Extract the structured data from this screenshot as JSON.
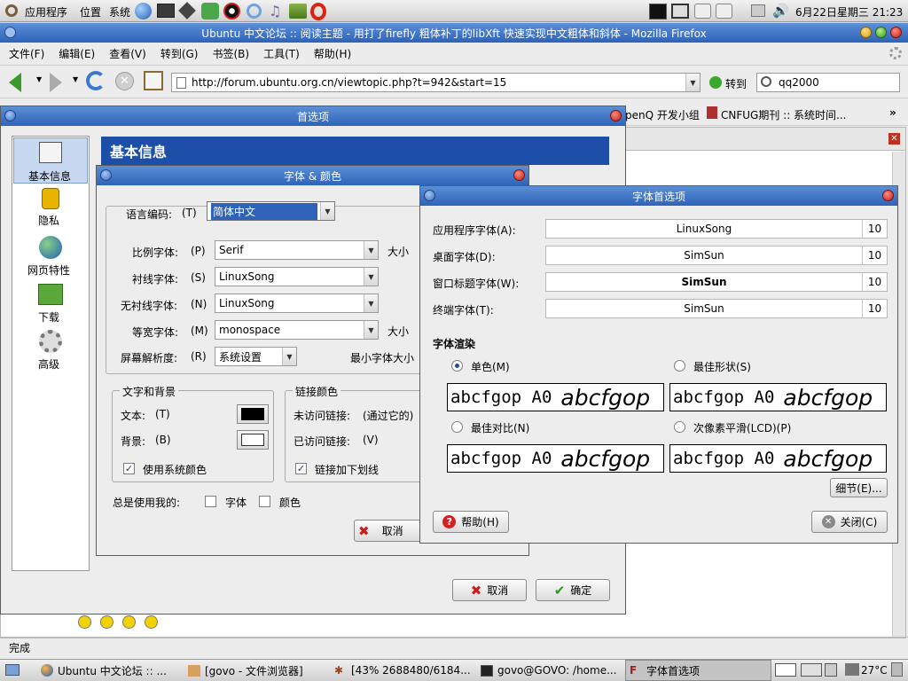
{
  "top_panel": {
    "apps": "应用程序",
    "places": "位置",
    "system": "系统",
    "clock": "6月22日星期三 21:23"
  },
  "firefox": {
    "title": "Ubuntu 中文论坛 :: 阅读主题 - 用打了firefly 粗体补丁的libXft 快速实现中文粗体和斜体 - Mozilla Firefox",
    "menu": [
      "文件(F)",
      "编辑(E)",
      "查看(V)",
      "转到(G)",
      "书签(B)",
      "工具(T)",
      "帮助(H)"
    ],
    "url": "http://forum.ubuntu.org.cn/viewtopic.php?t=942&start=15",
    "go_label": "转到",
    "search_value": "qq2000",
    "bookmarks": [
      "penQ 开发小组",
      "CNFUG期刊 :: 系统时间..."
    ],
    "status": "完成"
  },
  "prefs": {
    "title": "首选项",
    "sidebar": [
      {
        "label": "基本信息",
        "icon": "sliders-icon"
      },
      {
        "label": "隐私",
        "icon": "lock-icon"
      },
      {
        "label": "网页特性",
        "icon": "globe-icon"
      },
      {
        "label": "下载",
        "icon": "download-icon"
      },
      {
        "label": "高级",
        "icon": "gear-icon"
      }
    ],
    "header": "基本信息",
    "cancel": "取消",
    "ok": "确定"
  },
  "fonts_colors": {
    "title": "字体 & 颜色",
    "encoding_label": "语言编码:",
    "encoding_key": "(T)",
    "encoding_value": "简体中文",
    "rows": [
      {
        "label": "比例字体:",
        "key": "(P)",
        "value": "Serif"
      },
      {
        "label": "衬线字体:",
        "key": "(S)",
        "value": "LinuxSong"
      },
      {
        "label": "无衬线字体:",
        "key": "(N)",
        "value": "LinuxSong"
      },
      {
        "label": "等宽字体:",
        "key": "(M)",
        "value": "monospace"
      }
    ],
    "size_label": "大小",
    "resolution_label": "屏幕解析度:",
    "resolution_key": "(R)",
    "resolution_value": "系统设置",
    "min_size_label": "最小字体大小",
    "text_bg_title": "文字和背景",
    "text_label": "文本:",
    "text_key": "(T)",
    "bg_label": "背景:",
    "bg_key": "(B)",
    "use_system_colors": "使用系统颜色",
    "link_colors_title": "链接颜色",
    "unvisited_label": "未访问链接:",
    "unvisited_hint": "(通过它的)",
    "visited_label": "已访问链接:",
    "visited_key": "(V)",
    "underline_links": "链接加下划线",
    "always_use": "总是使用我的:",
    "fonts_opt": "字体",
    "colors_opt": "颜色",
    "cancel": "取消"
  },
  "font_prefs": {
    "title": "字体首选项",
    "rows": [
      {
        "label": "应用程序字体(A):",
        "font": "LinuxSong",
        "size": "10"
      },
      {
        "label": "桌面字体(D):",
        "font": "SimSun",
        "size": "10"
      },
      {
        "label": "窗口标题字体(W):",
        "font": "SimSun",
        "size": "10"
      },
      {
        "label": "终端字体(T):",
        "font": "SimSun",
        "size": "10"
      }
    ],
    "rendering_title": "字体渲染",
    "options": [
      {
        "label": "单色(M)",
        "selected": true
      },
      {
        "label": "最佳形状(S)",
        "selected": false
      },
      {
        "label": "最佳对比(N)",
        "selected": false
      },
      {
        "label": "次像素平滑(LCD)(P)",
        "selected": false
      }
    ],
    "sample_mono": "abcfgop A0",
    "sample_italic": "abcfgop",
    "details": "细节(E)...",
    "help": "帮助(H)",
    "close": "关闭(C)"
  },
  "taskbar": {
    "items": [
      "Ubuntu 中文论坛 :: ...",
      "[govo - 文件浏览器]",
      "[43% 2688480/6184...",
      "govo@GOVO: /home...",
      "字体首选项"
    ],
    "temp": "27°C"
  },
  "colors": {
    "title_blue": "#2f63b9",
    "header_blue": "#1d4fa8",
    "panel_gray": "#d6d6d6",
    "dialog_bg": "#ededed"
  }
}
